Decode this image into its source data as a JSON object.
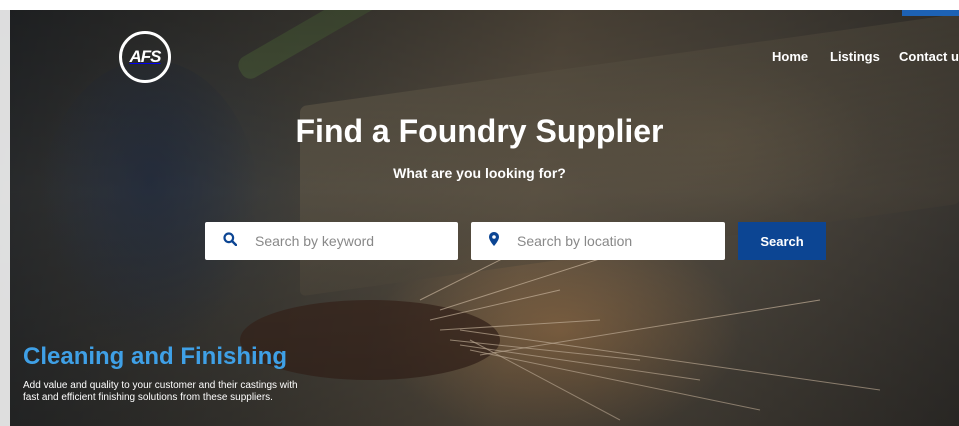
{
  "brand": {
    "logo_text": "AFS"
  },
  "nav": {
    "home": "Home",
    "listings": "Listings",
    "contact": "Contact us"
  },
  "hero": {
    "title": "Find a Foundry Supplier",
    "subtitle": "What are you looking for?"
  },
  "search": {
    "keyword_placeholder": "Search by keyword",
    "location_placeholder": "Search by location",
    "button_label": "Search"
  },
  "featured": {
    "title": "Cleaning and Finishing",
    "description": "Add value and quality to your customer and their castings with fast and efficient finishing solutions from these suppliers."
  },
  "icons": {
    "keyword": "search-icon",
    "location": "location-pin-icon"
  },
  "colors": {
    "accent": "#0c4593",
    "category_title": "#3fa0e6",
    "icon": "#0c4593"
  }
}
